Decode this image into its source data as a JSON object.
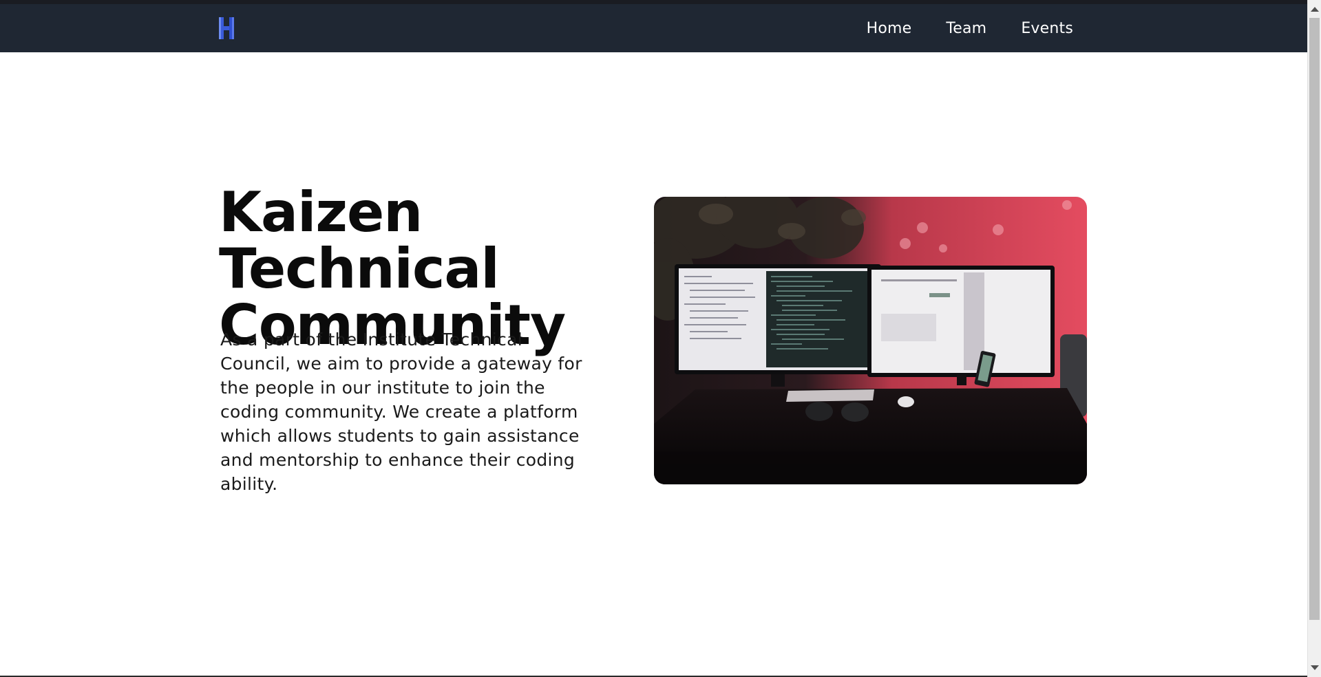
{
  "nav": {
    "logo_icon": "kaizen-k-logo",
    "logo_colors": [
      "#3a5bd9",
      "#6d8cf0"
    ],
    "links": [
      {
        "label": "Home"
      },
      {
        "label": "Team"
      },
      {
        "label": "Events"
      }
    ]
  },
  "hero": {
    "title": "Kaizen Technical Community",
    "description": "As a part of the Institute Technical Council, we aim to provide a gateway for the people in our institute to join the coding community. We create a platform which allows students to gain assistance and mentorship to enhance their coding ability.",
    "image_icon": "workspace-monitors-image"
  },
  "colors": {
    "navbar_bg": "#1f2733",
    "title_color": "#0b0b0b",
    "accent_red": "#e34a5e"
  }
}
